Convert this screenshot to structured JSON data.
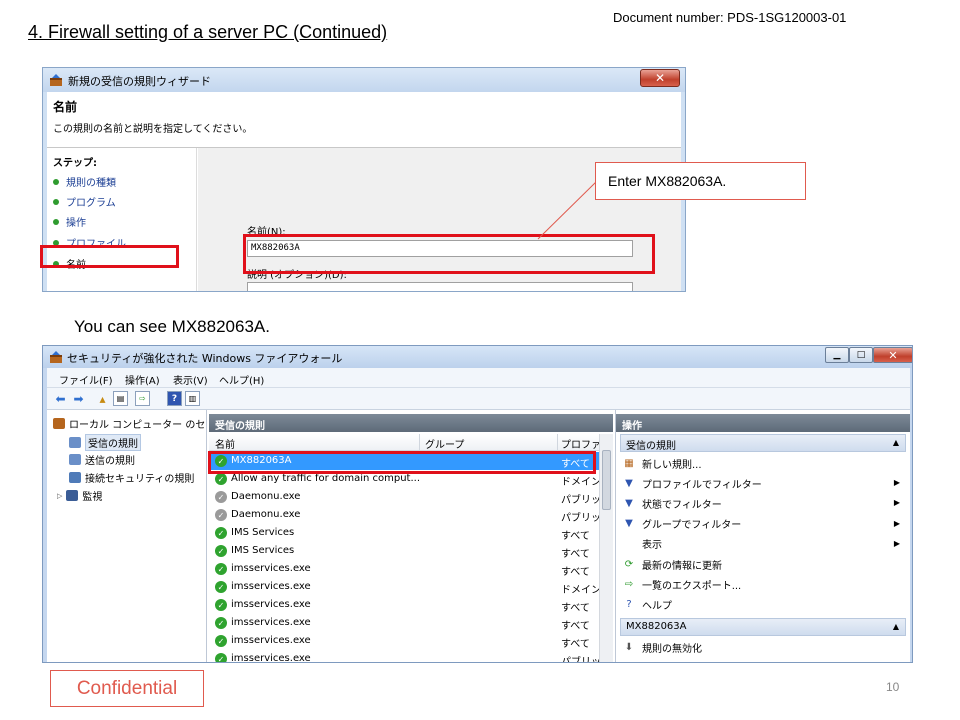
{
  "slide": {
    "title": "4. Firewall setting of a server PC (Continued)",
    "document_number": "Document number: PDS-1SG120003-01",
    "caption_second": "You can see MX882063A.",
    "callout": "Enter MX882063A.",
    "confidential": "Confidential",
    "page_number": "10"
  },
  "wizard": {
    "window_title": "新規の受信の規則ウィザード",
    "close_glyph": "✕",
    "header_title": "名前",
    "header_description": "この規則の名前と説明を指定してください。",
    "steps_title": "ステップ:",
    "steps": [
      "規則の種類",
      "プログラム",
      "操作",
      "プロファイル",
      "名前"
    ],
    "name_label": "名前(N):",
    "name_value": "MX882063A",
    "description_label": "説明 (オプション)(D):",
    "description_value": ""
  },
  "firewall": {
    "window_title": "セキュリティが強化された Windows ファイアウォール",
    "controls": {
      "minimize": "▁",
      "maximize": "□",
      "close": "✕"
    },
    "menu": [
      "ファイル(F)",
      "操作(A)",
      "表示(V)",
      "ヘルプ(H)"
    ],
    "tree": {
      "root": "ローカル コンピューター のセ",
      "items": [
        "受信の規則",
        "送信の規則",
        "接続セキュリティの規則",
        "監視"
      ]
    },
    "center_header": "受信の規則",
    "columns": [
      "名前",
      "グループ",
      "プロファ"
    ],
    "rows": [
      {
        "name": "MX882063A",
        "profile": "すべて",
        "status": "ok"
      },
      {
        "name": "Allow any traffic for domain comput...",
        "profile": "ドメイン",
        "status": "ok"
      },
      {
        "name": "Daemonu.exe",
        "profile": "パブリッ",
        "status": "grey"
      },
      {
        "name": "Daemonu.exe",
        "profile": "パブリッ",
        "status": "grey"
      },
      {
        "name": "IMS Services",
        "profile": "すべて",
        "status": "ok"
      },
      {
        "name": "IMS Services",
        "profile": "すべて",
        "status": "ok"
      },
      {
        "name": "imsservices.exe",
        "profile": "すべて",
        "status": "ok"
      },
      {
        "name": "imsservices.exe",
        "profile": "ドメイン",
        "status": "ok"
      },
      {
        "name": "imsservices.exe",
        "profile": "すべて",
        "status": "ok"
      },
      {
        "name": "imsservices.exe",
        "profile": "すべて",
        "status": "ok"
      },
      {
        "name": "imsservices.exe",
        "profile": "すべて",
        "status": "ok"
      },
      {
        "name": "imsservices.exe",
        "profile": "パブリッ",
        "status": "ok"
      }
    ],
    "actions": {
      "header": "操作",
      "section1": "受信の規則",
      "items1": [
        {
          "label": "新しい規則...",
          "icon": "new-rule-icon",
          "arrow": ""
        },
        {
          "label": "プロファイルでフィルター",
          "icon": "filter-icon",
          "arrow": "▶"
        },
        {
          "label": "状態でフィルター",
          "icon": "filter-icon",
          "arrow": "▶"
        },
        {
          "label": "グループでフィルター",
          "icon": "filter-icon",
          "arrow": "▶"
        },
        {
          "label": "表示",
          "icon": "",
          "arrow": "▶"
        },
        {
          "label": "最新の情報に更新",
          "icon": "refresh-icon",
          "arrow": ""
        },
        {
          "label": "一覧のエクスポート...",
          "icon": "export-icon",
          "arrow": ""
        },
        {
          "label": "ヘルプ",
          "icon": "help-icon",
          "arrow": ""
        }
      ],
      "section2": "MX882063A",
      "items2": [
        {
          "label": "規則の無効化",
          "icon": "disable-icon",
          "arrow": ""
        }
      ]
    }
  }
}
